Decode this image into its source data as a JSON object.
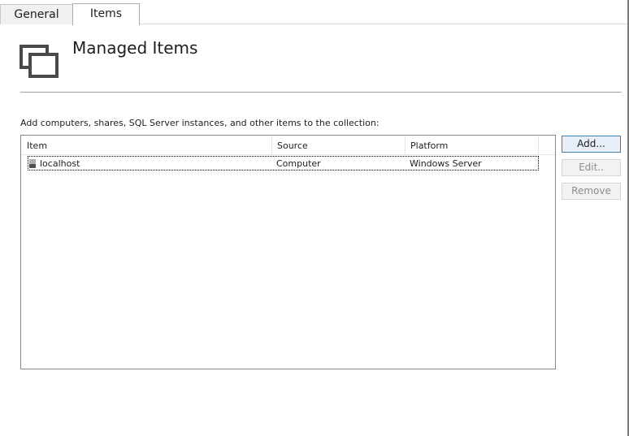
{
  "tabs": [
    {
      "label": "General",
      "selected": false
    },
    {
      "label": "Items",
      "selected": true
    }
  ],
  "header": {
    "icon": "managed-items-icon",
    "title": "Managed Items"
  },
  "instructions": "Add computers, shares, SQL Server instances, and other items to the collection:",
  "list": {
    "columns": [
      "Item",
      "Source",
      "Platform"
    ],
    "rows": [
      {
        "icon": "computer-icon",
        "item": "localhost",
        "source": "Computer",
        "platform": "Windows Server"
      }
    ]
  },
  "buttons": {
    "add": "Add...",
    "edit": "Edit..",
    "remove": "Remove"
  },
  "colors": {
    "accent_border": "#3c7fb1",
    "disabled_text": "#8c8c8c",
    "icon": "#4a4a4a"
  }
}
